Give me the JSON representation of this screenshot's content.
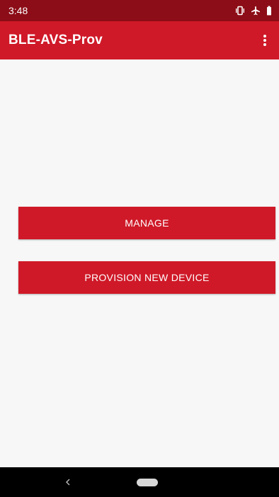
{
  "status_bar": {
    "time": "3:48",
    "icons": [
      "vibrate-icon",
      "airplane-mode-icon",
      "battery-icon"
    ]
  },
  "app_bar": {
    "title": "BLE-AVS-Prov",
    "overflow_icon": "more-vert-icon"
  },
  "main": {
    "buttons": [
      {
        "label": "MANAGE"
      },
      {
        "label": "PROVISION NEW DEVICE"
      }
    ]
  },
  "nav_bar": {
    "icons": [
      "back-icon",
      "home-pill-icon"
    ]
  },
  "colors": {
    "status_bar": "#8c0d17",
    "primary": "#cf1928",
    "background": "#f7f7f7",
    "nav_bar": "#000000"
  }
}
